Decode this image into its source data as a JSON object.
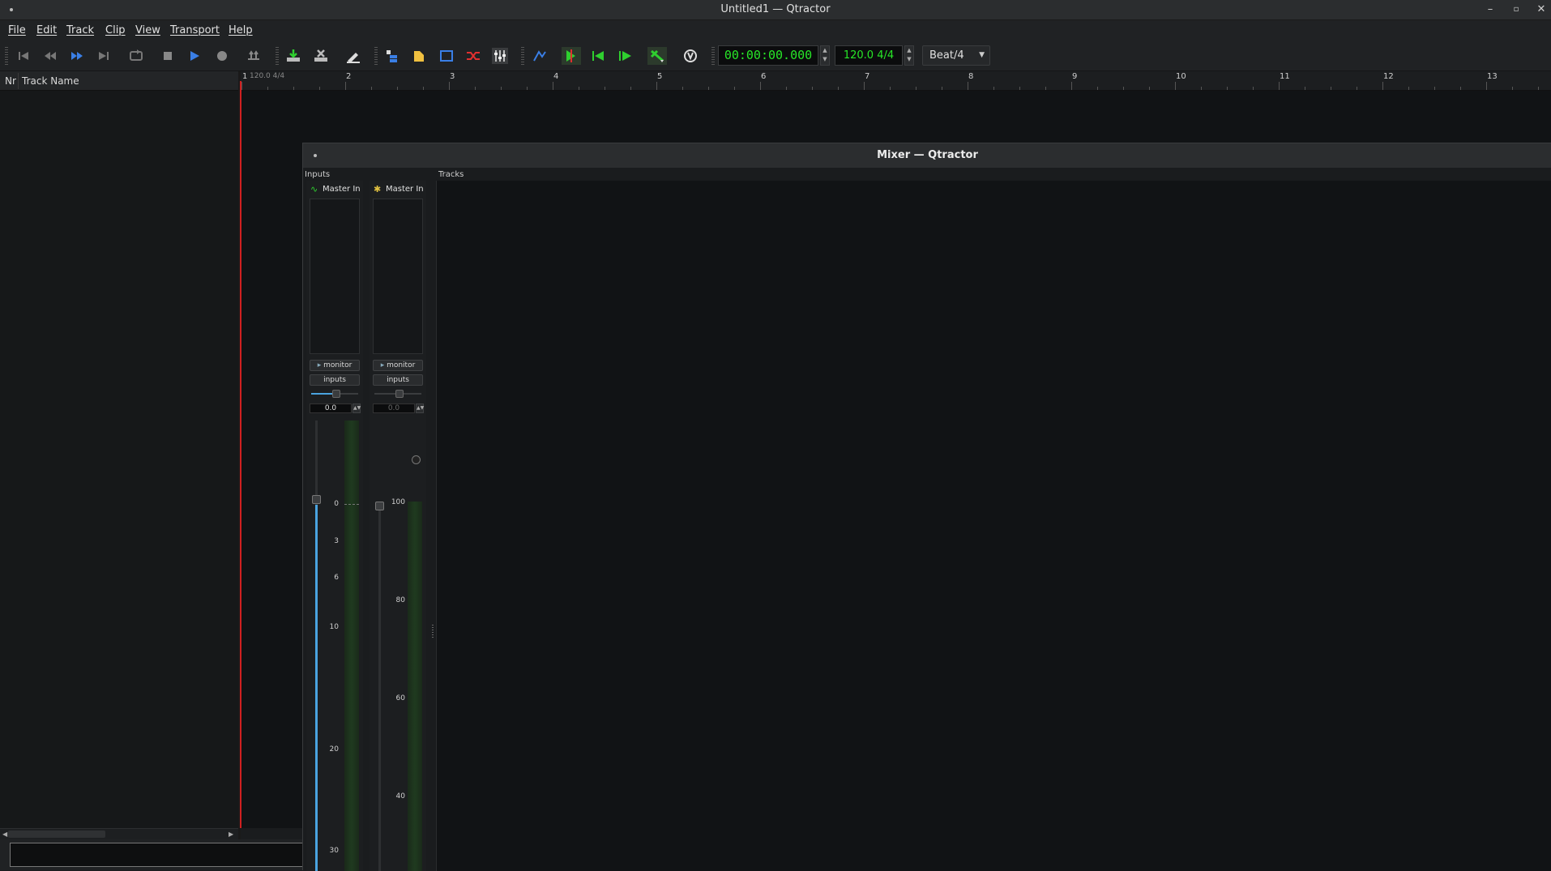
{
  "window": {
    "title": "Untitled1 — Qtractor"
  },
  "menu": [
    "File",
    "Edit",
    "Track",
    "Clip",
    "View",
    "Transport",
    "Help"
  ],
  "transport": {
    "time": "00:00:00.000",
    "tempo": "120.0 4/4",
    "snap": "Beat/4"
  },
  "tracklist": {
    "col_nr": "Nr",
    "col_name": "Track Name"
  },
  "ruler": {
    "tempo_marker": "120.0 4/4",
    "bars": [
      "1",
      "2",
      "3",
      "4",
      "5",
      "6",
      "7",
      "8",
      "9",
      "10",
      "11",
      "12",
      "13"
    ]
  },
  "mixer": {
    "title": "Mixer — Qtractor",
    "inputs_label": "Inputs",
    "tracks_label": "Tracks",
    "strips": [
      {
        "name": "Master In",
        "type": "audio",
        "monitor": "monitor",
        "inputs": "inputs",
        "gain": "0.0",
        "scale": [
          "0",
          "3",
          "6",
          "10",
          "20",
          "30"
        ]
      },
      {
        "name": "Master In",
        "type": "midi",
        "monitor": "monitor",
        "inputs": "inputs",
        "gain": "0.0",
        "scale": [
          "100",
          "80",
          "60",
          "40"
        ]
      }
    ]
  },
  "colors": {
    "accent": "#4aa3df",
    "lcd": "#27e627",
    "playhead": "#d02020"
  }
}
